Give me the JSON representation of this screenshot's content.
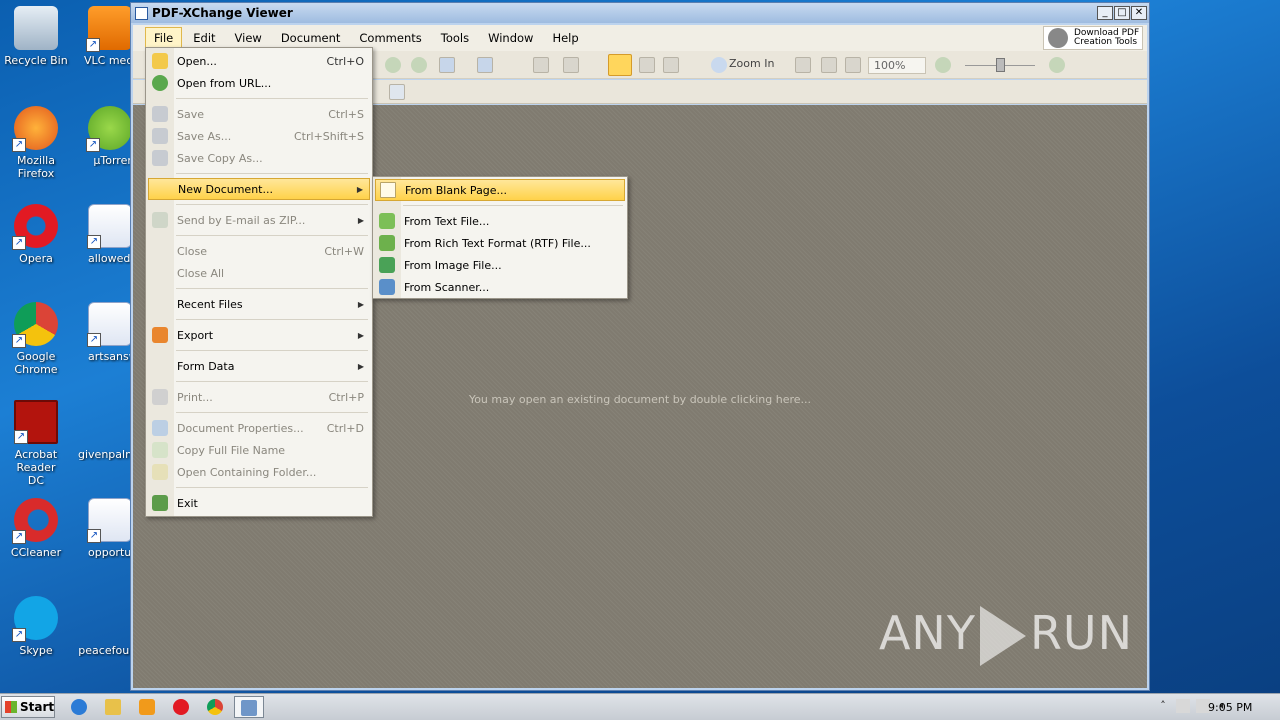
{
  "desktop": {
    "icons": [
      {
        "label": "Recycle Bin"
      },
      {
        "label": "VLC media player"
      },
      {
        "label": "Mozilla Firefox"
      },
      {
        "label": "µTorrent"
      },
      {
        "label": "Opera"
      },
      {
        "label": "allowedclea"
      },
      {
        "label": "Google Chrome"
      },
      {
        "label": "artsanswer"
      },
      {
        "label": "Acrobat Reader DC"
      },
      {
        "label": "givenpalm."
      },
      {
        "label": "CCleaner"
      },
      {
        "label": "opportunit"
      },
      {
        "label": "Skype"
      },
      {
        "label": "peacefour"
      }
    ]
  },
  "window": {
    "title": "PDF-XChange Viewer",
    "buttons": {
      "min": "_",
      "max": "□",
      "close": "✕"
    }
  },
  "menubar": {
    "items": [
      "File",
      "Edit",
      "View",
      "Document",
      "Comments",
      "Tools",
      "Window",
      "Help"
    ],
    "download_tools": {
      "line1": "Download PDF",
      "line2": "Creation Tools"
    }
  },
  "toolbar": {
    "zoom_in_label": "Zoom In",
    "zoom_value": "100%"
  },
  "content": {
    "hint": "You may open an existing document by double clicking here..."
  },
  "watermark": {
    "left": "ANY",
    "right": "RUN"
  },
  "file_menu": {
    "items": [
      {
        "label": "Open...",
        "shortcut": "Ctrl+O"
      },
      {
        "label": "Open from URL...",
        "shortcut": ""
      },
      {
        "label": "Save",
        "shortcut": "Ctrl+S"
      },
      {
        "label": "Save As...",
        "shortcut": "Ctrl+Shift+S"
      },
      {
        "label": "Save Copy As...",
        "shortcut": ""
      },
      {
        "label": "New Document...",
        "shortcut": ""
      },
      {
        "label": "Send by E-mail as ZIP...",
        "shortcut": ""
      },
      {
        "label": "Close",
        "shortcut": "Ctrl+W"
      },
      {
        "label": "Close All",
        "shortcut": ""
      },
      {
        "label": "Recent Files",
        "shortcut": ""
      },
      {
        "label": "Export",
        "shortcut": ""
      },
      {
        "label": "Form Data",
        "shortcut": ""
      },
      {
        "label": "Print...",
        "shortcut": "Ctrl+P"
      },
      {
        "label": "Document Properties...",
        "shortcut": "Ctrl+D"
      },
      {
        "label": "Copy Full File Name",
        "shortcut": ""
      },
      {
        "label": "Open Containing Folder...",
        "shortcut": ""
      },
      {
        "label": "Exit",
        "shortcut": ""
      }
    ]
  },
  "new_doc_submenu": {
    "items": [
      {
        "label": "From Blank Page..."
      },
      {
        "label": "From Text File..."
      },
      {
        "label": "From Rich Text Format (RTF) File..."
      },
      {
        "label": "From Image File..."
      },
      {
        "label": "From Scanner..."
      }
    ]
  },
  "taskbar": {
    "start_label": "Start",
    "clock": "9:05 PM"
  }
}
